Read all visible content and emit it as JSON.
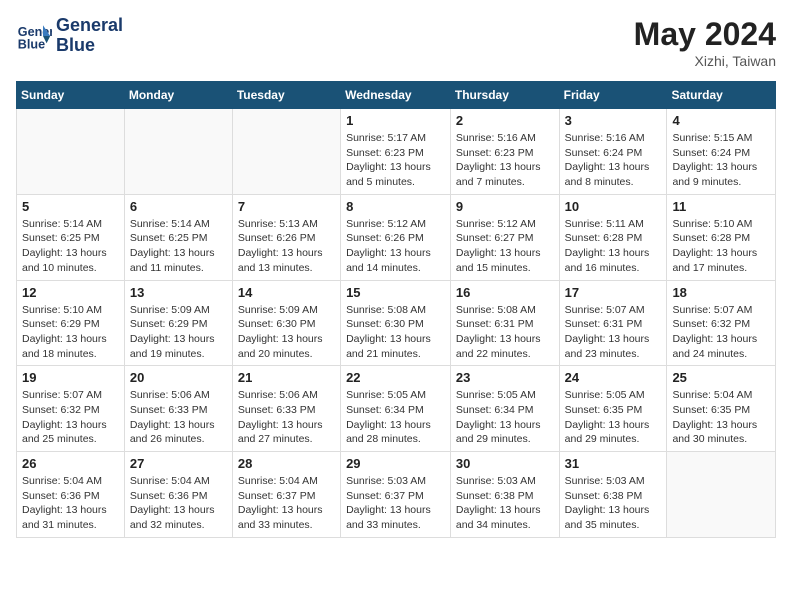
{
  "header": {
    "logo_line1": "General",
    "logo_line2": "Blue",
    "month_year": "May 2024",
    "location": "Xizhi, Taiwan"
  },
  "weekdays": [
    "Sunday",
    "Monday",
    "Tuesday",
    "Wednesday",
    "Thursday",
    "Friday",
    "Saturday"
  ],
  "weeks": [
    [
      {
        "day": "",
        "info": ""
      },
      {
        "day": "",
        "info": ""
      },
      {
        "day": "",
        "info": ""
      },
      {
        "day": "1",
        "info": "Sunrise: 5:17 AM\nSunset: 6:23 PM\nDaylight: 13 hours\nand 5 minutes."
      },
      {
        "day": "2",
        "info": "Sunrise: 5:16 AM\nSunset: 6:23 PM\nDaylight: 13 hours\nand 7 minutes."
      },
      {
        "day": "3",
        "info": "Sunrise: 5:16 AM\nSunset: 6:24 PM\nDaylight: 13 hours\nand 8 minutes."
      },
      {
        "day": "4",
        "info": "Sunrise: 5:15 AM\nSunset: 6:24 PM\nDaylight: 13 hours\nand 9 minutes."
      }
    ],
    [
      {
        "day": "5",
        "info": "Sunrise: 5:14 AM\nSunset: 6:25 PM\nDaylight: 13 hours\nand 10 minutes."
      },
      {
        "day": "6",
        "info": "Sunrise: 5:14 AM\nSunset: 6:25 PM\nDaylight: 13 hours\nand 11 minutes."
      },
      {
        "day": "7",
        "info": "Sunrise: 5:13 AM\nSunset: 6:26 PM\nDaylight: 13 hours\nand 13 minutes."
      },
      {
        "day": "8",
        "info": "Sunrise: 5:12 AM\nSunset: 6:26 PM\nDaylight: 13 hours\nand 14 minutes."
      },
      {
        "day": "9",
        "info": "Sunrise: 5:12 AM\nSunset: 6:27 PM\nDaylight: 13 hours\nand 15 minutes."
      },
      {
        "day": "10",
        "info": "Sunrise: 5:11 AM\nSunset: 6:28 PM\nDaylight: 13 hours\nand 16 minutes."
      },
      {
        "day": "11",
        "info": "Sunrise: 5:10 AM\nSunset: 6:28 PM\nDaylight: 13 hours\nand 17 minutes."
      }
    ],
    [
      {
        "day": "12",
        "info": "Sunrise: 5:10 AM\nSunset: 6:29 PM\nDaylight: 13 hours\nand 18 minutes."
      },
      {
        "day": "13",
        "info": "Sunrise: 5:09 AM\nSunset: 6:29 PM\nDaylight: 13 hours\nand 19 minutes."
      },
      {
        "day": "14",
        "info": "Sunrise: 5:09 AM\nSunset: 6:30 PM\nDaylight: 13 hours\nand 20 minutes."
      },
      {
        "day": "15",
        "info": "Sunrise: 5:08 AM\nSunset: 6:30 PM\nDaylight: 13 hours\nand 21 minutes."
      },
      {
        "day": "16",
        "info": "Sunrise: 5:08 AM\nSunset: 6:31 PM\nDaylight: 13 hours\nand 22 minutes."
      },
      {
        "day": "17",
        "info": "Sunrise: 5:07 AM\nSunset: 6:31 PM\nDaylight: 13 hours\nand 23 minutes."
      },
      {
        "day": "18",
        "info": "Sunrise: 5:07 AM\nSunset: 6:32 PM\nDaylight: 13 hours\nand 24 minutes."
      }
    ],
    [
      {
        "day": "19",
        "info": "Sunrise: 5:07 AM\nSunset: 6:32 PM\nDaylight: 13 hours\nand 25 minutes."
      },
      {
        "day": "20",
        "info": "Sunrise: 5:06 AM\nSunset: 6:33 PM\nDaylight: 13 hours\nand 26 minutes."
      },
      {
        "day": "21",
        "info": "Sunrise: 5:06 AM\nSunset: 6:33 PM\nDaylight: 13 hours\nand 27 minutes."
      },
      {
        "day": "22",
        "info": "Sunrise: 5:05 AM\nSunset: 6:34 PM\nDaylight: 13 hours\nand 28 minutes."
      },
      {
        "day": "23",
        "info": "Sunrise: 5:05 AM\nSunset: 6:34 PM\nDaylight: 13 hours\nand 29 minutes."
      },
      {
        "day": "24",
        "info": "Sunrise: 5:05 AM\nSunset: 6:35 PM\nDaylight: 13 hours\nand 29 minutes."
      },
      {
        "day": "25",
        "info": "Sunrise: 5:04 AM\nSunset: 6:35 PM\nDaylight: 13 hours\nand 30 minutes."
      }
    ],
    [
      {
        "day": "26",
        "info": "Sunrise: 5:04 AM\nSunset: 6:36 PM\nDaylight: 13 hours\nand 31 minutes."
      },
      {
        "day": "27",
        "info": "Sunrise: 5:04 AM\nSunset: 6:36 PM\nDaylight: 13 hours\nand 32 minutes."
      },
      {
        "day": "28",
        "info": "Sunrise: 5:04 AM\nSunset: 6:37 PM\nDaylight: 13 hours\nand 33 minutes."
      },
      {
        "day": "29",
        "info": "Sunrise: 5:03 AM\nSunset: 6:37 PM\nDaylight: 13 hours\nand 33 minutes."
      },
      {
        "day": "30",
        "info": "Sunrise: 5:03 AM\nSunset: 6:38 PM\nDaylight: 13 hours\nand 34 minutes."
      },
      {
        "day": "31",
        "info": "Sunrise: 5:03 AM\nSunset: 6:38 PM\nDaylight: 13 hours\nand 35 minutes."
      },
      {
        "day": "",
        "info": ""
      }
    ]
  ]
}
